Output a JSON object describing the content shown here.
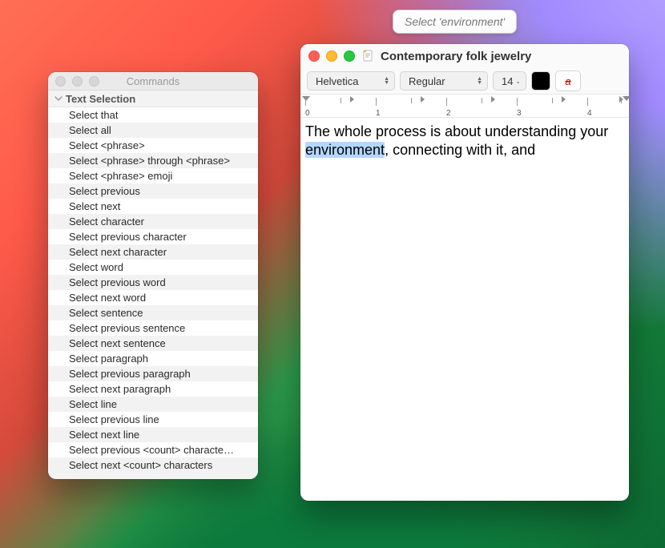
{
  "tooltip": {
    "text": "Select 'environment'"
  },
  "commands_window": {
    "title": "Commands",
    "section": "Text Selection",
    "items": [
      "Select that",
      "Select all",
      "Select <phrase>",
      "Select <phrase> through <phrase>",
      "Select <phrase> emoji",
      "Select previous",
      "Select next",
      "Select character",
      "Select previous character",
      "Select next character",
      "Select word",
      "Select previous word",
      "Select next word",
      "Select sentence",
      "Select previous sentence",
      "Select next sentence",
      "Select paragraph",
      "Select previous paragraph",
      "Select next paragraph",
      "Select line",
      "Select previous line",
      "Select next line",
      "Select previous <count> characte…",
      "Select next <count> characters"
    ]
  },
  "editor_window": {
    "title": "Contemporary folk jewelry",
    "toolbar": {
      "font_family": "Helvetica",
      "font_style": "Regular",
      "font_size": "14",
      "text_color": "#000000",
      "strikethrough_glyph": "a"
    },
    "ruler": {
      "labels": [
        "0",
        "1",
        "2",
        "3",
        "4"
      ]
    },
    "body": {
      "pre": "The whole process is about understanding your ",
      "highlight": "environment",
      "post": ", connecting with it, and"
    }
  }
}
